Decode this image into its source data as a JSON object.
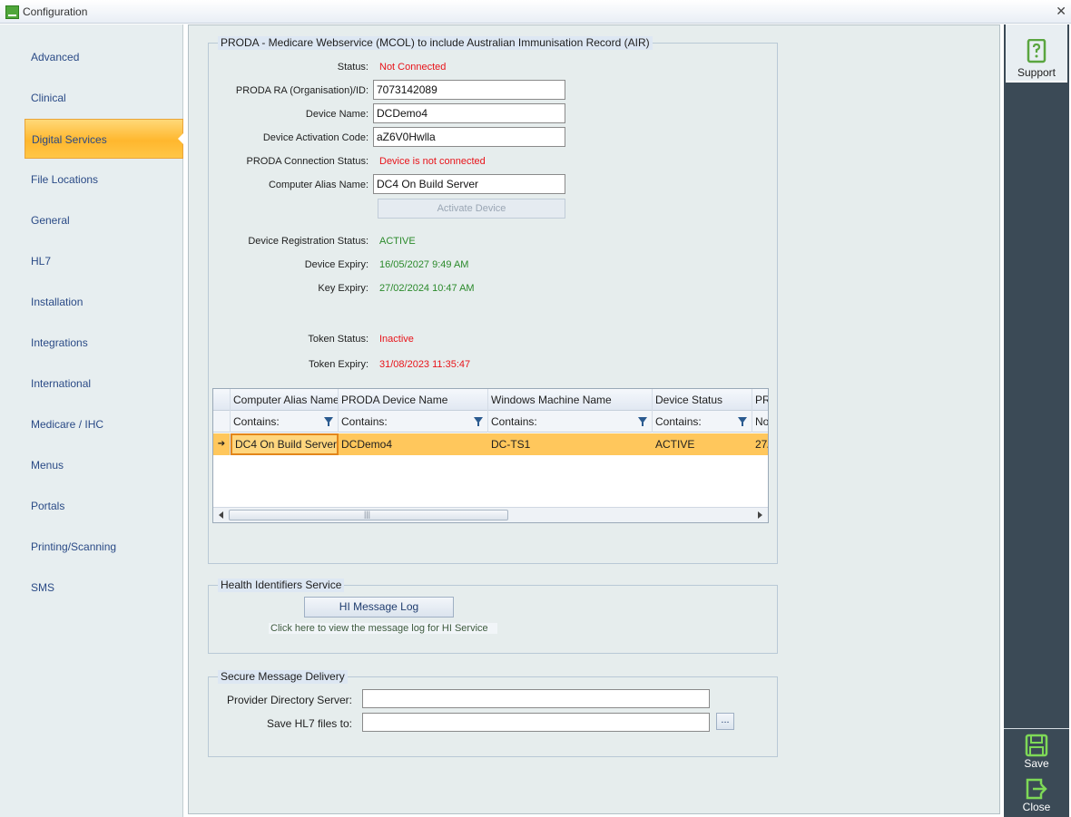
{
  "window": {
    "title": "Configuration",
    "close_glyph": "✕"
  },
  "nav": {
    "items": [
      {
        "label": "Advanced"
      },
      {
        "label": "Clinical"
      },
      {
        "label": "Digital Services",
        "active": true
      },
      {
        "label": "File Locations"
      },
      {
        "label": "General"
      },
      {
        "label": "HL7"
      },
      {
        "label": "Installation"
      },
      {
        "label": "Integrations"
      },
      {
        "label": "International"
      },
      {
        "label": "Medicare / IHC"
      },
      {
        "label": "Menus"
      },
      {
        "label": "Portals"
      },
      {
        "label": "Printing/Scanning"
      },
      {
        "label": "SMS"
      }
    ]
  },
  "proda": {
    "group_title": "PRODA - Medicare Webservice (MCOL) to include Australian Immunisation Record (AIR)",
    "status_label": "Status:",
    "status_value": "Not Connected",
    "ra_label": "PRODA RA (Organisation)/ID:",
    "ra_value": "7073142089",
    "device_name_label": "Device Name:",
    "device_name_value": "DCDemo4",
    "activation_code_label": "Device Activation Code:",
    "activation_code_value": "aZ6V0Hwlla",
    "connection_status_label": "PRODA Connection Status:",
    "connection_status_value": "Device is not connected",
    "alias_label": "Computer Alias Name:",
    "alias_value": "DC4 On Build Server",
    "activate_button": "Activate Device",
    "reg_status_label": "Device Registration Status:",
    "reg_status_value": "ACTIVE",
    "device_expiry_label": "Device Expiry:",
    "device_expiry_value": "16/05/2027 9:49 AM",
    "key_expiry_label": "Key Expiry:",
    "key_expiry_value": "27/02/2024 10:47 AM",
    "token_status_label": "Token Status:",
    "token_status_value": "Inactive",
    "token_expiry_label": "Token Expiry:",
    "token_expiry_value": "31/08/2023 11:35:47"
  },
  "grid": {
    "columns": [
      "Computer Alias Name",
      "PRODA Device Name",
      "Windows Machine Name",
      "Device Status",
      "PR"
    ],
    "filters": [
      "Contains:",
      "Contains:",
      "Contains:",
      "Contains:",
      "No"
    ],
    "rows": [
      [
        "DC4 On Build Server",
        "DCDemo4",
        "DC-TS1",
        "ACTIVE",
        "27/"
      ]
    ],
    "row_indicator": "➔",
    "scroll_thumb_glyph": "|||"
  },
  "hi": {
    "group_title": "Health Identifiers Service",
    "button": "HI Message Log",
    "hint": "Click here to view the message log for HI Service"
  },
  "smd": {
    "group_title": "Secure Message Delivery",
    "provider_label": "Provider Directory Server:",
    "provider_value": "",
    "save_label": "Save HL7 files to:",
    "save_value": "",
    "browse_button": "..."
  },
  "sidebar_right": {
    "support": "Support",
    "save": "Save",
    "close": "Close"
  },
  "colors": {
    "accent_orange": "#ffb72e",
    "status_red": "#e8141a",
    "status_green": "#2b8a2b",
    "icon_green": "#7ed957"
  }
}
